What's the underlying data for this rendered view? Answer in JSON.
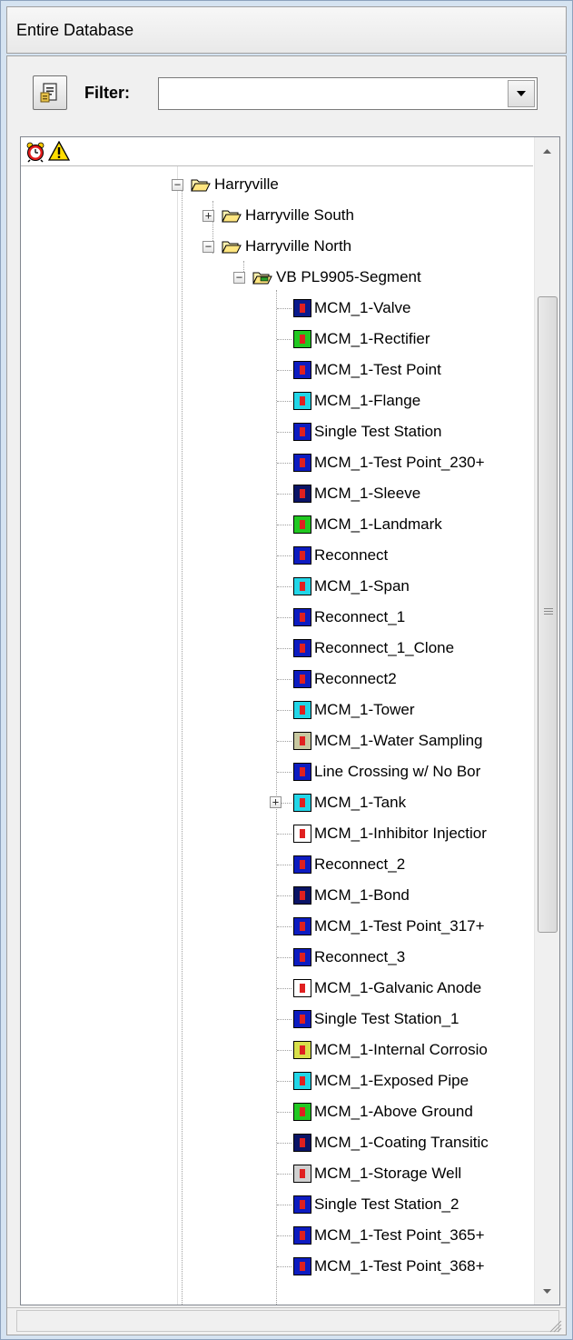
{
  "window": {
    "title": "Entire Database"
  },
  "toolbar": {
    "button_icon": "report-icon",
    "filter_label": "Filter:",
    "filter_value": ""
  },
  "tree": {
    "header_icons": [
      "alarm-clock-icon",
      "warning-icon"
    ],
    "root": {
      "label": "Harryville",
      "expanded": true
    },
    "children": [
      {
        "label": "Harryville South",
        "expanded": false
      },
      {
        "label": "Harryville North",
        "expanded": true
      }
    ],
    "segment": {
      "label": "VB PL9905-Segment",
      "expanded": true
    },
    "items": [
      {
        "label": "MCM_1-Valve",
        "icon": "valve-icon",
        "bg": "#0a1a8c"
      },
      {
        "label": "MCM_1-Rectifier",
        "icon": "rectifier-icon",
        "bg": "#21c821"
      },
      {
        "label": "MCM_1-Test Point",
        "icon": "test-point-icon",
        "bg": "#0d1cc0"
      },
      {
        "label": "MCM_1-Flange",
        "icon": "flange-icon",
        "bg": "#22d6e8"
      },
      {
        "label": "Single Test Station",
        "icon": "test-station-icon",
        "bg": "#0d1cc0"
      },
      {
        "label": "MCM_1-Test Point_230+",
        "icon": "test-point-icon",
        "bg": "#0d1cc0"
      },
      {
        "label": "MCM_1-Sleeve",
        "icon": "sleeve-icon",
        "bg": "#0a1466"
      },
      {
        "label": "MCM_1-Landmark",
        "icon": "landmark-icon",
        "bg": "#21c821"
      },
      {
        "label": "Reconnect",
        "icon": "reconnect-icon",
        "bg": "#0d1cc0"
      },
      {
        "label": "MCM_1-Span",
        "icon": "span-icon",
        "bg": "#22d6e8"
      },
      {
        "label": "Reconnect_1",
        "icon": "reconnect-icon",
        "bg": "#0d1cc0"
      },
      {
        "label": "Reconnect_1_Clone",
        "icon": "reconnect-icon",
        "bg": "#0d1cc0"
      },
      {
        "label": "Reconnect2",
        "icon": "reconnect-icon",
        "bg": "#0d1cc0"
      },
      {
        "label": "MCM_1-Tower",
        "icon": "tower-icon",
        "bg": "#22d6e8"
      },
      {
        "label": "MCM_1-Water Sampling",
        "icon": "water-sampling-icon",
        "bg": "#c8c8a0"
      },
      {
        "label": "Line Crossing w/ No Bor",
        "icon": "line-crossing-icon",
        "bg": "#0d1cc0"
      },
      {
        "label": "MCM_1-Tank",
        "icon": "tank-icon",
        "bg": "#22d6e8",
        "expandable": true
      },
      {
        "label": "MCM_1-Inhibitor Injectior",
        "icon": "inhibitor-injection-icon",
        "bg": "#ffffff"
      },
      {
        "label": "Reconnect_2",
        "icon": "reconnect-icon",
        "bg": "#0d1cc0"
      },
      {
        "label": "MCM_1-Bond",
        "icon": "bond-icon",
        "bg": "#0a1466"
      },
      {
        "label": "MCM_1-Test Point_317+",
        "icon": "test-point-icon",
        "bg": "#0d1cc0"
      },
      {
        "label": "Reconnect_3",
        "icon": "reconnect-icon",
        "bg": "#0d1cc0"
      },
      {
        "label": "MCM_1-Galvanic Anode",
        "icon": "galvanic-anode-icon",
        "bg": "#ffffff"
      },
      {
        "label": "Single Test Station_1",
        "icon": "test-station-icon",
        "bg": "#0d1cc0"
      },
      {
        "label": "MCM_1-Internal Corrosio",
        "icon": "internal-corrosion-icon",
        "bg": "#d8e04a"
      },
      {
        "label": "MCM_1-Exposed Pipe",
        "icon": "exposed-pipe-icon",
        "bg": "#22d6e8"
      },
      {
        "label": "MCM_1-Above Ground",
        "icon": "above-ground-icon",
        "bg": "#21c821"
      },
      {
        "label": "MCM_1-Coating Transitic",
        "icon": "coating-transition-icon",
        "bg": "#0a1466"
      },
      {
        "label": "MCM_1-Storage Well",
        "icon": "storage-well-icon",
        "bg": "#d0d0d0"
      },
      {
        "label": "Single Test Station_2",
        "icon": "test-station-icon",
        "bg": "#0d1cc0"
      },
      {
        "label": "MCM_1-Test Point_365+",
        "icon": "test-point-icon",
        "bg": "#0d1cc0"
      },
      {
        "label": "MCM_1-Test Point_368+",
        "icon": "test-point-icon",
        "bg": "#0d1cc0"
      }
    ]
  }
}
